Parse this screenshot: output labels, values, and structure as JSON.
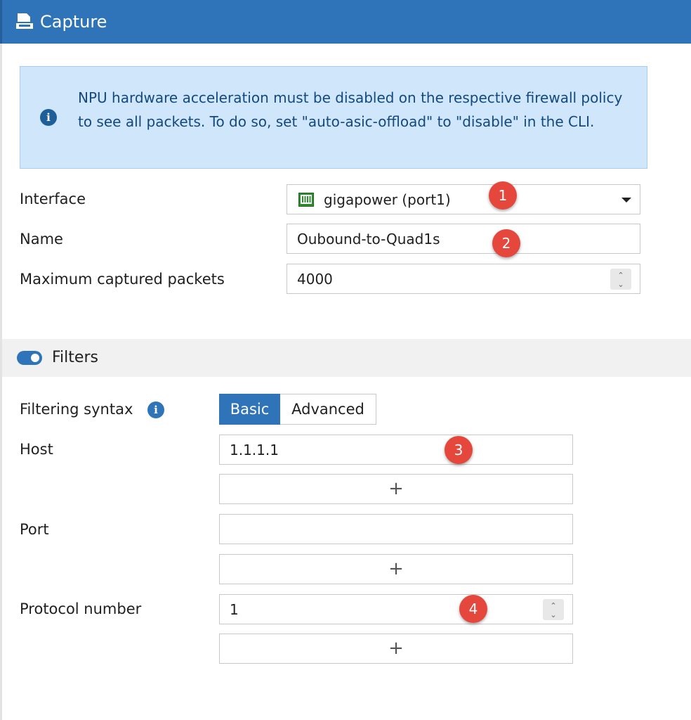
{
  "header": {
    "title": "Capture",
    "icon": "capture-icon",
    "background": "#2f74b9"
  },
  "notice": {
    "icon": "info-icon",
    "text": "NPU hardware acceleration must be disabled on the respective firewall policy to see all packets. To do so, set \"auto-asic-offload\" to \"disable\" in the CLI."
  },
  "form": {
    "interface": {
      "label": "Interface",
      "value": "gigapower (port1)",
      "icon": "ethernet-port-icon"
    },
    "name": {
      "label": "Name",
      "value": "Oubound-to-Quad1s"
    },
    "max_packets": {
      "label": "Maximum captured packets",
      "value": "4000"
    }
  },
  "filters": {
    "title": "Filters",
    "enabled": true,
    "syntax": {
      "label": "Filtering syntax",
      "options": [
        "Basic",
        "Advanced"
      ],
      "selected": "Basic"
    },
    "host": {
      "label": "Host",
      "value": "1.1.1.1",
      "add": "+"
    },
    "port": {
      "label": "Port",
      "value": "",
      "add": "+"
    },
    "protocol": {
      "label": "Protocol number",
      "value": "1",
      "add": "+"
    }
  },
  "annotations": [
    "1",
    "2",
    "3",
    "4"
  ],
  "colors": {
    "accent": "#2f74b9",
    "notice_bg": "#cfe6fb",
    "badge": "#e5473c"
  }
}
